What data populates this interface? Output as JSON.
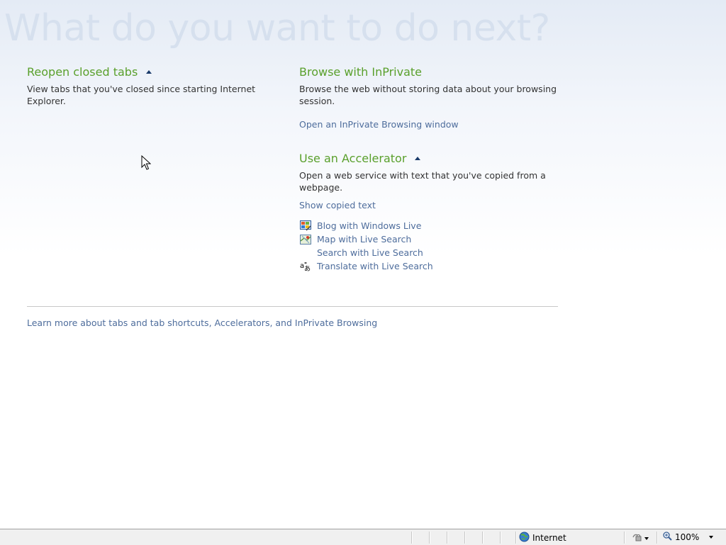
{
  "hero_title": "What do you want to do next?",
  "reopen": {
    "title": "Reopen closed tabs",
    "description": "View tabs that you've closed since starting Internet Explorer."
  },
  "inprivate": {
    "title": "Browse with InPrivate",
    "description": "Browse the web without storing data about your browsing session.",
    "link": "Open an InPrivate Browsing window"
  },
  "accelerator": {
    "title": "Use an Accelerator",
    "description": "Open a web service with text that you've copied from a webpage.",
    "show_copied": "Show copied text",
    "items": [
      {
        "label": "Blog with Windows Live",
        "icon": "windows-live-icon"
      },
      {
        "label": "Map with Live Search",
        "icon": "map-icon"
      },
      {
        "label": "Search with Live Search",
        "icon": ""
      },
      {
        "label": "Translate with Live Search",
        "icon": "translate-icon"
      }
    ]
  },
  "footer": {
    "learn_more": "Learn more about tabs and tab shortcuts, Accelerators, and InPrivate Browsing"
  },
  "statusbar": {
    "zone": "Internet",
    "zoom": "100%"
  },
  "colors": {
    "heading_green": "#5aa02c",
    "link_blue": "#4e6d9c",
    "hero_text": "#d6e0ee"
  }
}
